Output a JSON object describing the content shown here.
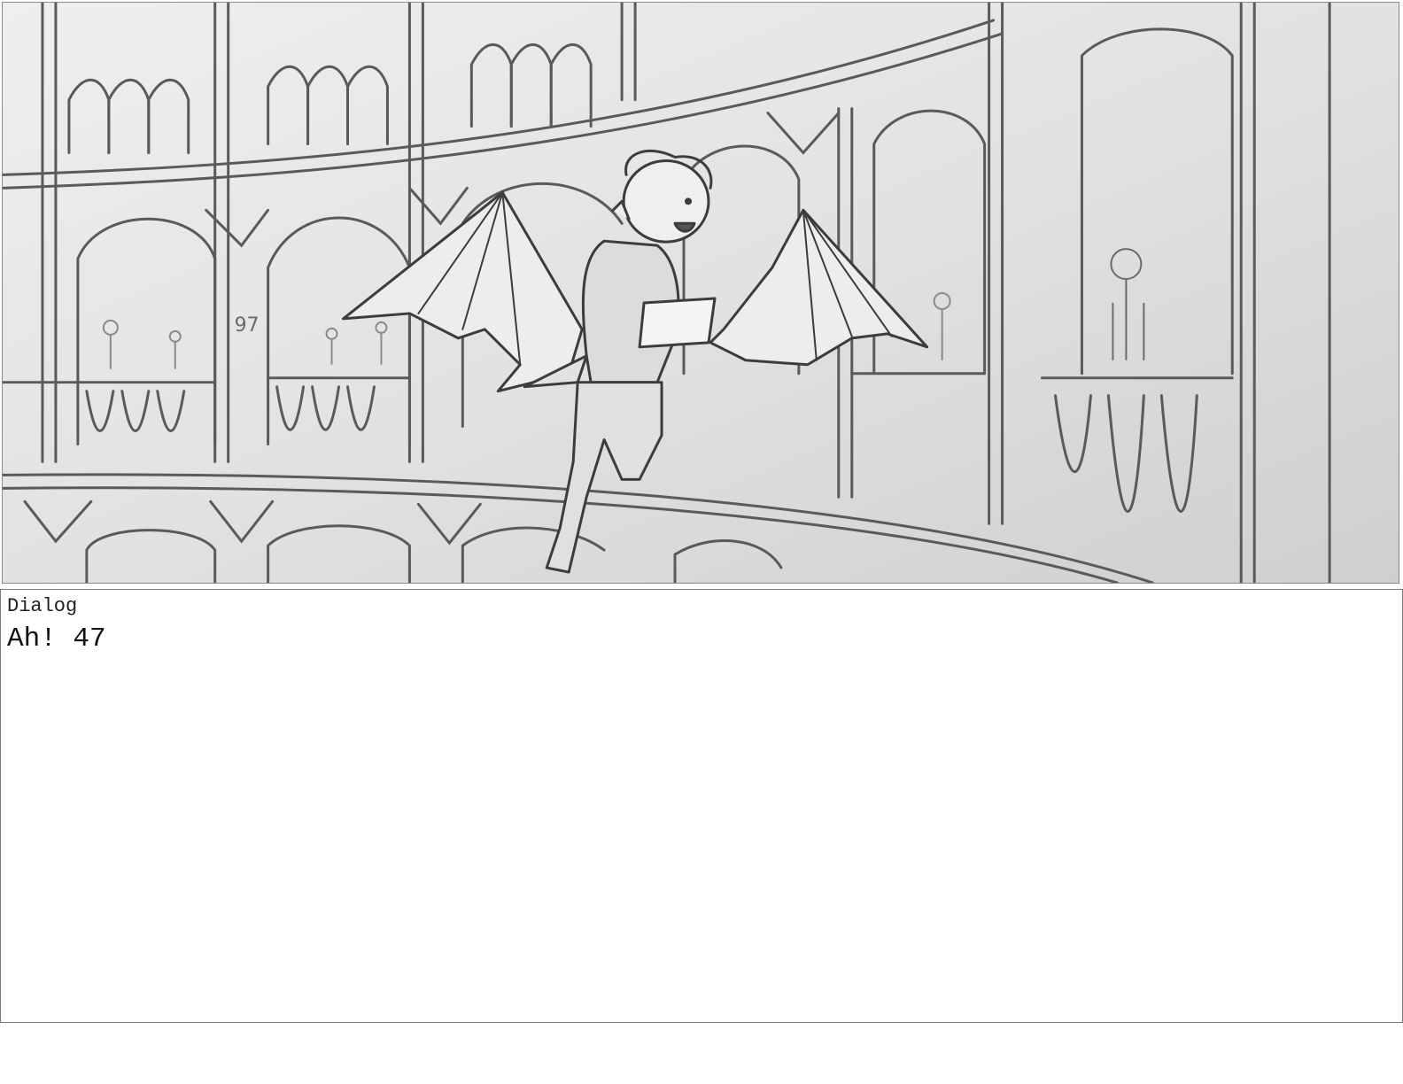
{
  "panel": {
    "background_color": "#e2e2e2",
    "line_color": "#5c5c5c",
    "scene_number": "97"
  },
  "dialog": {
    "label": "Dialog",
    "text": "Ah! 47"
  }
}
